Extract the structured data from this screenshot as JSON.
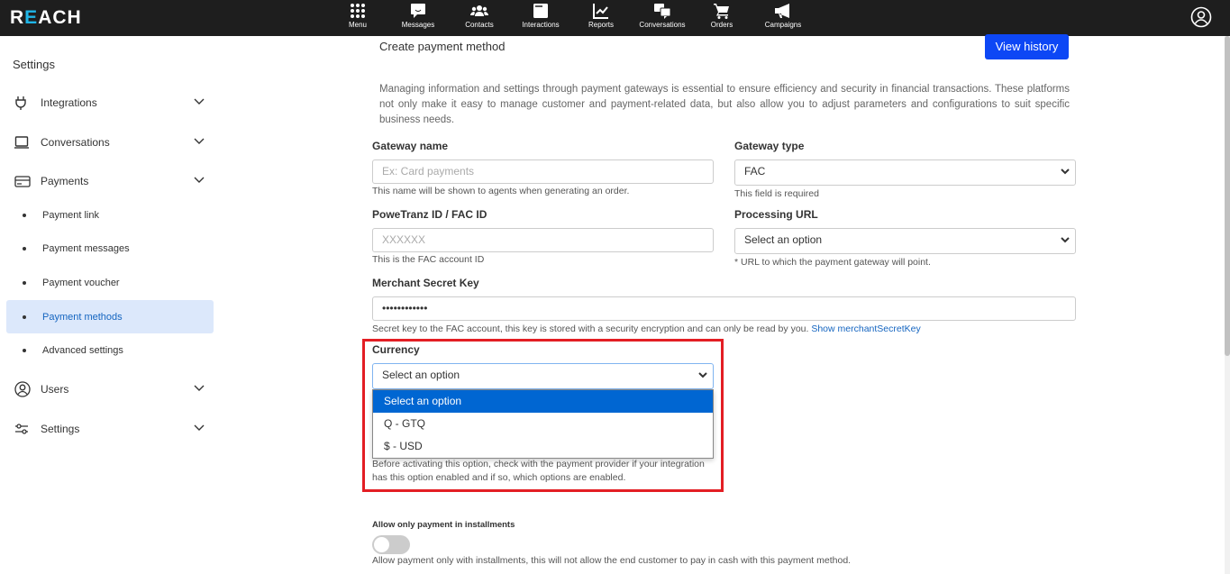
{
  "app": {
    "logo": "REACH"
  },
  "nav": [
    {
      "label": "Menu",
      "icon": "grid-icon"
    },
    {
      "label": "Messages",
      "icon": "message-icon"
    },
    {
      "label": "Contacts",
      "icon": "contacts-icon"
    },
    {
      "label": "Interactions",
      "icon": "interactions-icon"
    },
    {
      "label": "Reports",
      "icon": "chart-icon"
    },
    {
      "label": "Conversations",
      "icon": "conversations-icon"
    },
    {
      "label": "Orders",
      "icon": "cart-icon"
    },
    {
      "label": "Campaigns",
      "icon": "megaphone-icon"
    }
  ],
  "sidebar": {
    "title": "Settings",
    "items": [
      {
        "label": "Integrations"
      },
      {
        "label": "Conversations"
      },
      {
        "label": "Payments"
      },
      {
        "label": "Users"
      },
      {
        "label": "Settings"
      }
    ],
    "subitems": [
      {
        "label": "Payment link"
      },
      {
        "label": "Payment messages"
      },
      {
        "label": "Payment voucher"
      },
      {
        "label": "Payment methods",
        "active": true
      },
      {
        "label": "Advanced settings"
      }
    ]
  },
  "form": {
    "title": "Create payment method",
    "view_history": "View history",
    "description": "Managing information and settings through payment gateways is essential to ensure efficiency and security in financial transactions. These platforms not only make it easy to manage customer and payment-related data, but also allow you to adjust parameters and configurations to suit specific business needs.",
    "gateway_name": {
      "label": "Gateway name",
      "placeholder": "Ex: Card payments",
      "hint": "This name will be shown to agents when generating an order."
    },
    "gateway_type": {
      "label": "Gateway type",
      "value": "FAC",
      "hint": "This field is required"
    },
    "fac_id": {
      "label": "PoweTranz ID / FAC ID",
      "placeholder": "XXXXXX",
      "hint": "This is the FAC account ID"
    },
    "processing_url": {
      "label": "Processing URL",
      "value": "Select an option",
      "hint": "* URL to which the payment gateway will point."
    },
    "secret_key": {
      "label": "Merchant Secret Key",
      "value": "••••••••••••",
      "hint": "Secret key to the FAC account, this key is stored with a security encryption and can only be read by you.",
      "link": "Show merchantSecretKey"
    },
    "currency": {
      "label": "Currency",
      "value": "Select an option",
      "options": [
        "Select an option",
        "Q - GTQ",
        "$ - USD"
      ],
      "hint": "Before activating this option, check with the payment provider if your integration has this option enabled and if so, which options are enabled."
    },
    "installments": {
      "label": "Allow only payment in installments",
      "enabled": false,
      "hint": "Allow payment only with installments, this will not allow the end customer to pay in cash with this payment method."
    }
  },
  "colors": {
    "accent": "#0d47f5",
    "highlight": "#e31e24",
    "topbar": "#1e1e1e"
  }
}
